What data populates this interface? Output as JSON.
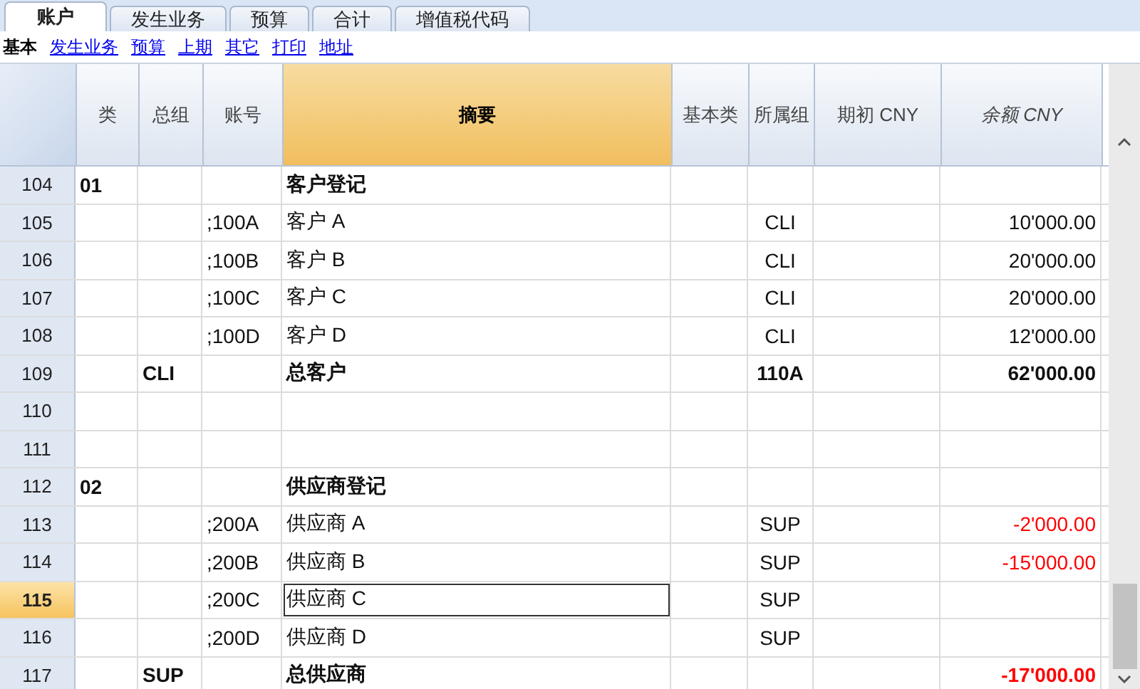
{
  "tabs": [
    {
      "label": "账户",
      "selected": true
    },
    {
      "label": "发生业务",
      "selected": false
    },
    {
      "label": "预算",
      "selected": false
    },
    {
      "label": "合计",
      "selected": false
    },
    {
      "label": "增值税代码",
      "selected": false
    }
  ],
  "views": [
    {
      "label": "基本",
      "selected": true
    },
    {
      "label": "发生业务",
      "selected": false
    },
    {
      "label": "预算",
      "selected": false
    },
    {
      "label": "上期",
      "selected": false
    },
    {
      "label": "其它",
      "selected": false
    },
    {
      "label": "打印",
      "selected": false
    },
    {
      "label": "地址",
      "selected": false
    }
  ],
  "table": {
    "columns": [
      {
        "label": "类",
        "italic": false,
        "highlighted": false
      },
      {
        "label": "总组",
        "italic": false,
        "highlighted": false
      },
      {
        "label": "账号",
        "italic": false,
        "highlighted": false
      },
      {
        "label": "摘要",
        "italic": false,
        "highlighted": true
      },
      {
        "label": "基本类",
        "italic": false,
        "highlighted": false
      },
      {
        "label": "所属组",
        "italic": false,
        "highlighted": false
      },
      {
        "label": "期初 CNY",
        "italic": false,
        "highlighted": false
      },
      {
        "label": "余额 CNY",
        "italic": true,
        "highlighted": false
      }
    ],
    "rows": [
      {
        "number": "104",
        "kind": "group",
        "selected": false,
        "cells": [
          "01",
          "",
          "",
          "客户登记",
          "",
          "",
          "",
          ""
        ]
      },
      {
        "number": "105",
        "kind": "account",
        "selected": false,
        "negative": false,
        "cells": [
          "",
          "",
          ";100A",
          "客户 A",
          "",
          "CLI",
          "",
          "10'000.00"
        ]
      },
      {
        "number": "106",
        "kind": "account",
        "selected": false,
        "negative": false,
        "cells": [
          "",
          "",
          ";100B",
          "客户 B",
          "",
          "CLI",
          "",
          "20'000.00"
        ]
      },
      {
        "number": "107",
        "kind": "account",
        "selected": false,
        "negative": false,
        "cells": [
          "",
          "",
          ";100C",
          "客户 C",
          "",
          "CLI",
          "",
          "20'000.00"
        ]
      },
      {
        "number": "108",
        "kind": "account",
        "selected": false,
        "negative": false,
        "cells": [
          "",
          "",
          ";100D",
          "客户 D",
          "",
          "CLI",
          "",
          "12'000.00"
        ]
      },
      {
        "number": "109",
        "kind": "group",
        "selected": false,
        "negative": false,
        "cells": [
          "",
          "CLI",
          "",
          "总客户",
          "",
          "110A",
          "",
          "62'000.00"
        ]
      },
      {
        "number": "110",
        "kind": "account",
        "selected": false,
        "cells": [
          "",
          "",
          "",
          "",
          "",
          "",
          "",
          ""
        ]
      },
      {
        "number": "111",
        "kind": "account",
        "selected": false,
        "cells": [
          "",
          "",
          "",
          "",
          "",
          "",
          "",
          ""
        ]
      },
      {
        "number": "112",
        "kind": "group",
        "selected": false,
        "cells": [
          "02",
          "",
          "",
          "供应商登记",
          "",
          "",
          "",
          ""
        ]
      },
      {
        "number": "113",
        "kind": "account",
        "selected": false,
        "negative": true,
        "cells": [
          "",
          "",
          ";200A",
          "供应商 A",
          "",
          "SUP",
          "",
          "-2'000.00"
        ]
      },
      {
        "number": "114",
        "kind": "account",
        "selected": false,
        "negative": true,
        "cells": [
          "",
          "",
          ";200B",
          "供应商 B",
          "",
          "SUP",
          "",
          "-15'000.00"
        ]
      },
      {
        "number": "115",
        "kind": "account",
        "selected": true,
        "cells": [
          "",
          "",
          ";200C",
          "供应商 C",
          "",
          "SUP",
          "",
          ""
        ]
      },
      {
        "number": "116",
        "kind": "account",
        "selected": false,
        "cells": [
          "",
          "",
          ";200D",
          "供应商 D",
          "",
          "SUP",
          "",
          ""
        ]
      },
      {
        "number": "117",
        "kind": "group",
        "selected": false,
        "negative": true,
        "cells": [
          "",
          "SUP",
          "",
          "总供应商",
          "",
          "",
          "",
          "-17'000.00"
        ]
      }
    ]
  }
}
